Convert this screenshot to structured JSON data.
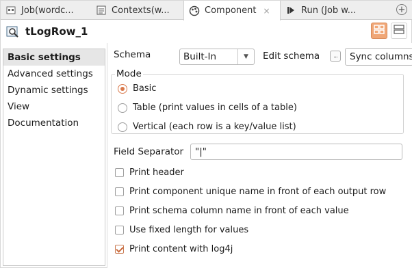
{
  "tabs": [
    {
      "label": "Job(wordc...",
      "icon": "job-icon"
    },
    {
      "label": "Contexts(w...",
      "icon": "contexts-icon"
    },
    {
      "label": "Component",
      "icon": "component-icon",
      "close": "×"
    },
    {
      "label": "Run (Job w...",
      "icon": "run-icon"
    }
  ],
  "add_tab": "+",
  "component": {
    "title": "tLogRow_1",
    "icon": "component-search-icon"
  },
  "sidebar": {
    "items": [
      {
        "label": "Basic settings"
      },
      {
        "label": "Advanced settings"
      },
      {
        "label": "Dynamic settings"
      },
      {
        "label": "View"
      },
      {
        "label": "Documentation"
      }
    ],
    "selected": "Basic settings"
  },
  "schema": {
    "label": "Schema",
    "value": "Built-In",
    "edit_label": "Edit schema",
    "edit_button": "...",
    "sync_label": "Sync columns"
  },
  "mode": {
    "label": "Mode",
    "options": [
      {
        "label": "Basic",
        "selected": true
      },
      {
        "label": "Table (print values in cells of a table)",
        "selected": false
      },
      {
        "label": "Vertical (each row is a key/value list)",
        "selected": false
      }
    ]
  },
  "field_separator": {
    "label": "Field Separator",
    "value": "\"|\""
  },
  "checkboxes": [
    {
      "label": "Print header",
      "checked": false
    },
    {
      "label": "Print component unique name in front of each output row",
      "checked": false
    },
    {
      "label": "Print schema column name in front of each value",
      "checked": false
    },
    {
      "label": "Use fixed length for values",
      "checked": false
    },
    {
      "label": "Print content with log4j",
      "checked": true
    }
  ],
  "colors": {
    "accent": "#d9784a",
    "selected_bg": "#e6e6e6",
    "toggle_active": "#f0a777"
  }
}
